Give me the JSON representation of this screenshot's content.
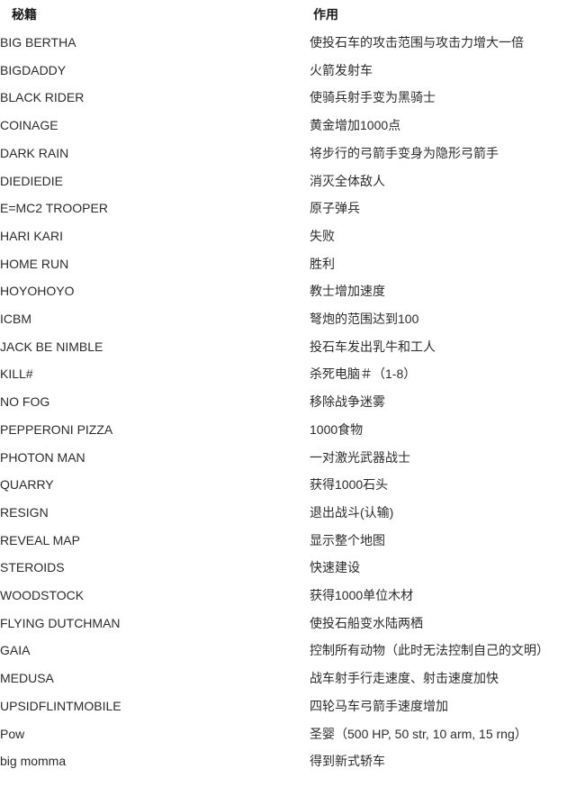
{
  "table": {
    "headers": {
      "code": "秘籍",
      "effect": "作用"
    },
    "rows": [
      {
        "code": "BIG BERTHA",
        "effect": "使投石车的攻击范围与攻击力增大一倍"
      },
      {
        "code": "BIGDADDY",
        "effect": "火箭发射车"
      },
      {
        "code": "BLACK RIDER",
        "effect": "使骑兵射手变为黑骑士"
      },
      {
        "code": "COINAGE",
        "effect": "黄金增加1000点"
      },
      {
        "code": "DARK RAIN",
        "effect": "将步行的弓箭手变身为隐形弓箭手"
      },
      {
        "code": "DIEDIEDIE",
        "effect": "消灭全体敌人"
      },
      {
        "code": "E=MC2 TROOPER",
        "effect": "原子弹兵"
      },
      {
        "code": "HARI KARI",
        "effect": "失败"
      },
      {
        "code": "HOME RUN",
        "effect": "胜利"
      },
      {
        "code": "HOYOHOYO",
        "effect": "教士增加速度"
      },
      {
        "code": "ICBM",
        "effect": "弩炮的范围达到100"
      },
      {
        "code": "JACK BE NIMBLE",
        "effect": "投石车发出乳牛和工人"
      },
      {
        "code": "KILL#",
        "effect": "杀死电脑＃（1-8）"
      },
      {
        "code": "NO FOG",
        "effect": "移除战争迷雾"
      },
      {
        "code": "PEPPERONI PIZZA",
        "effect": "1000食物"
      },
      {
        "code": "PHOTON MAN",
        "effect": "一对激光武器战士"
      },
      {
        "code": "QUARRY",
        "effect": "获得1000石头"
      },
      {
        "code": "RESIGN",
        "effect": "退出战斗(认输)"
      },
      {
        "code": "REVEAL MAP",
        "effect": "显示整个地图"
      },
      {
        "code": "STEROIDS",
        "effect": "快速建设"
      },
      {
        "code": "WOODSTOCK",
        "effect": "获得1000单位木材"
      },
      {
        "code": "FLYING DUTCHMAN",
        "effect": "使投石船变水陆两栖"
      },
      {
        "code": "GAIA",
        "effect": "控制所有动物（此时无法控制自己的文明）"
      },
      {
        "code": "MEDUSA",
        "effect": "战车射手行走速度、射击速度加快"
      },
      {
        "code": "UPSIDFLINTMOBILE",
        "effect": "四轮马车弓箭手速度增加"
      },
      {
        "code": "Pow",
        "effect": "圣婴（500 HP, 50 str, 10 arm, 15 rng）"
      },
      {
        "code": "big momma",
        "effect": "得到新式轿车"
      }
    ]
  },
  "colors": {
    "background": "#ffffff",
    "text": "#2b2b2b",
    "header_text": "#1a1a1a"
  }
}
